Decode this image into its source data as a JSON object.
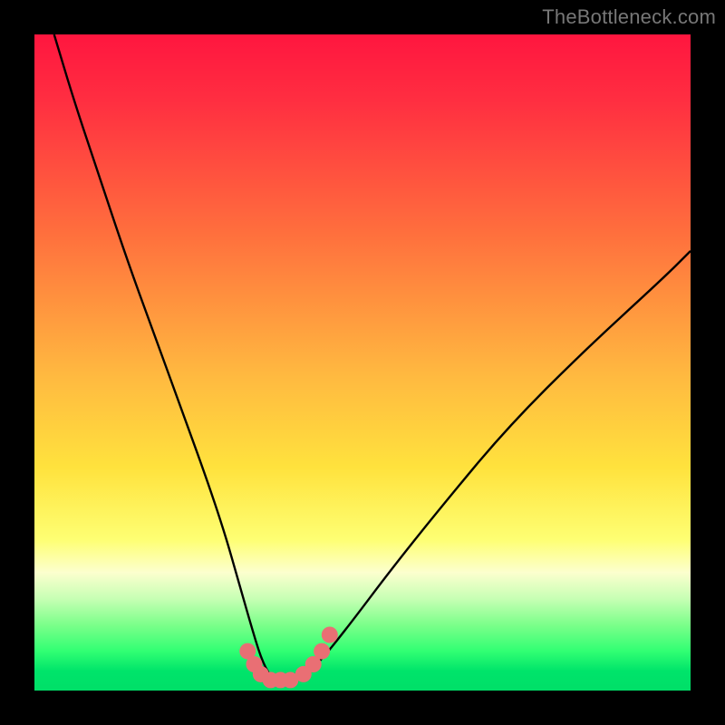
{
  "watermark": "TheBottleneck.com",
  "chart_data": {
    "type": "line",
    "title": "",
    "xlabel": "",
    "ylabel": "",
    "xlim": [
      0,
      100
    ],
    "ylim": [
      0,
      100
    ],
    "series": [
      {
        "name": "bottleneck-curve",
        "x": [
          3,
          6,
          10,
          14,
          18,
          22,
          26,
          29,
          31,
          33,
          34.5,
          36,
          38,
          41,
          44,
          48,
          54,
          62,
          72,
          84,
          96,
          100
        ],
        "y": [
          100,
          90,
          78,
          66,
          55,
          44,
          33,
          24,
          17,
          10,
          5,
          2,
          0.8,
          2,
          5,
          10,
          18,
          28,
          40,
          52,
          63,
          67
        ]
      }
    ],
    "markers": {
      "name": "highlight-dots",
      "x": [
        32.5,
        33.5,
        34.5,
        36.0,
        37.5,
        39.0,
        41.0,
        42.5,
        43.8,
        45.0
      ],
      "y": [
        6.0,
        4.0,
        2.5,
        1.6,
        1.6,
        1.6,
        2.5,
        4.0,
        6.0,
        8.5
      ]
    },
    "colors": {
      "curve": "#000000",
      "markers": "#e96f74",
      "gradient_top": "#ff163f",
      "gradient_bottom": "#00df68"
    }
  }
}
